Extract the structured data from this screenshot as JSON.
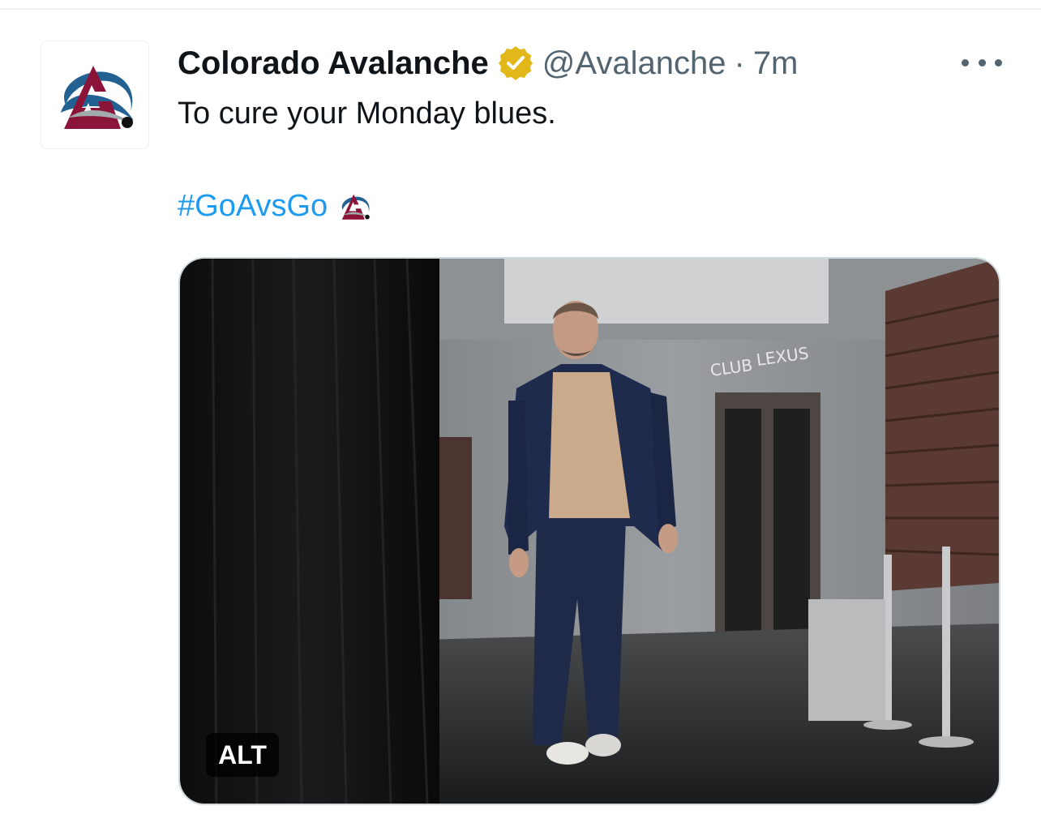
{
  "tweet": {
    "author": {
      "display_name": "Colorado Avalanche",
      "handle": "@Avalanche",
      "verified_icon": "gold-verified-badge-icon",
      "avatar_icon": "colorado-avalanche-logo"
    },
    "separator": "·",
    "time": "7m",
    "text": "To cure your Monday blues.",
    "hashtag": "#GoAvsGo",
    "hashtag_emoji_icon": "avalanche-logo-emoji",
    "more_icon": "more-options-icon",
    "media": {
      "alt_label": "ALT",
      "description_icon": "photo-player-walking-arena-hallway"
    }
  },
  "colors": {
    "text": "#0f1419",
    "secondary": "#536471",
    "link": "#1d9bf0",
    "verified_gold": "#e2b719",
    "avalanche_burgundy": "#8a1538",
    "avalanche_blue": "#236192"
  }
}
